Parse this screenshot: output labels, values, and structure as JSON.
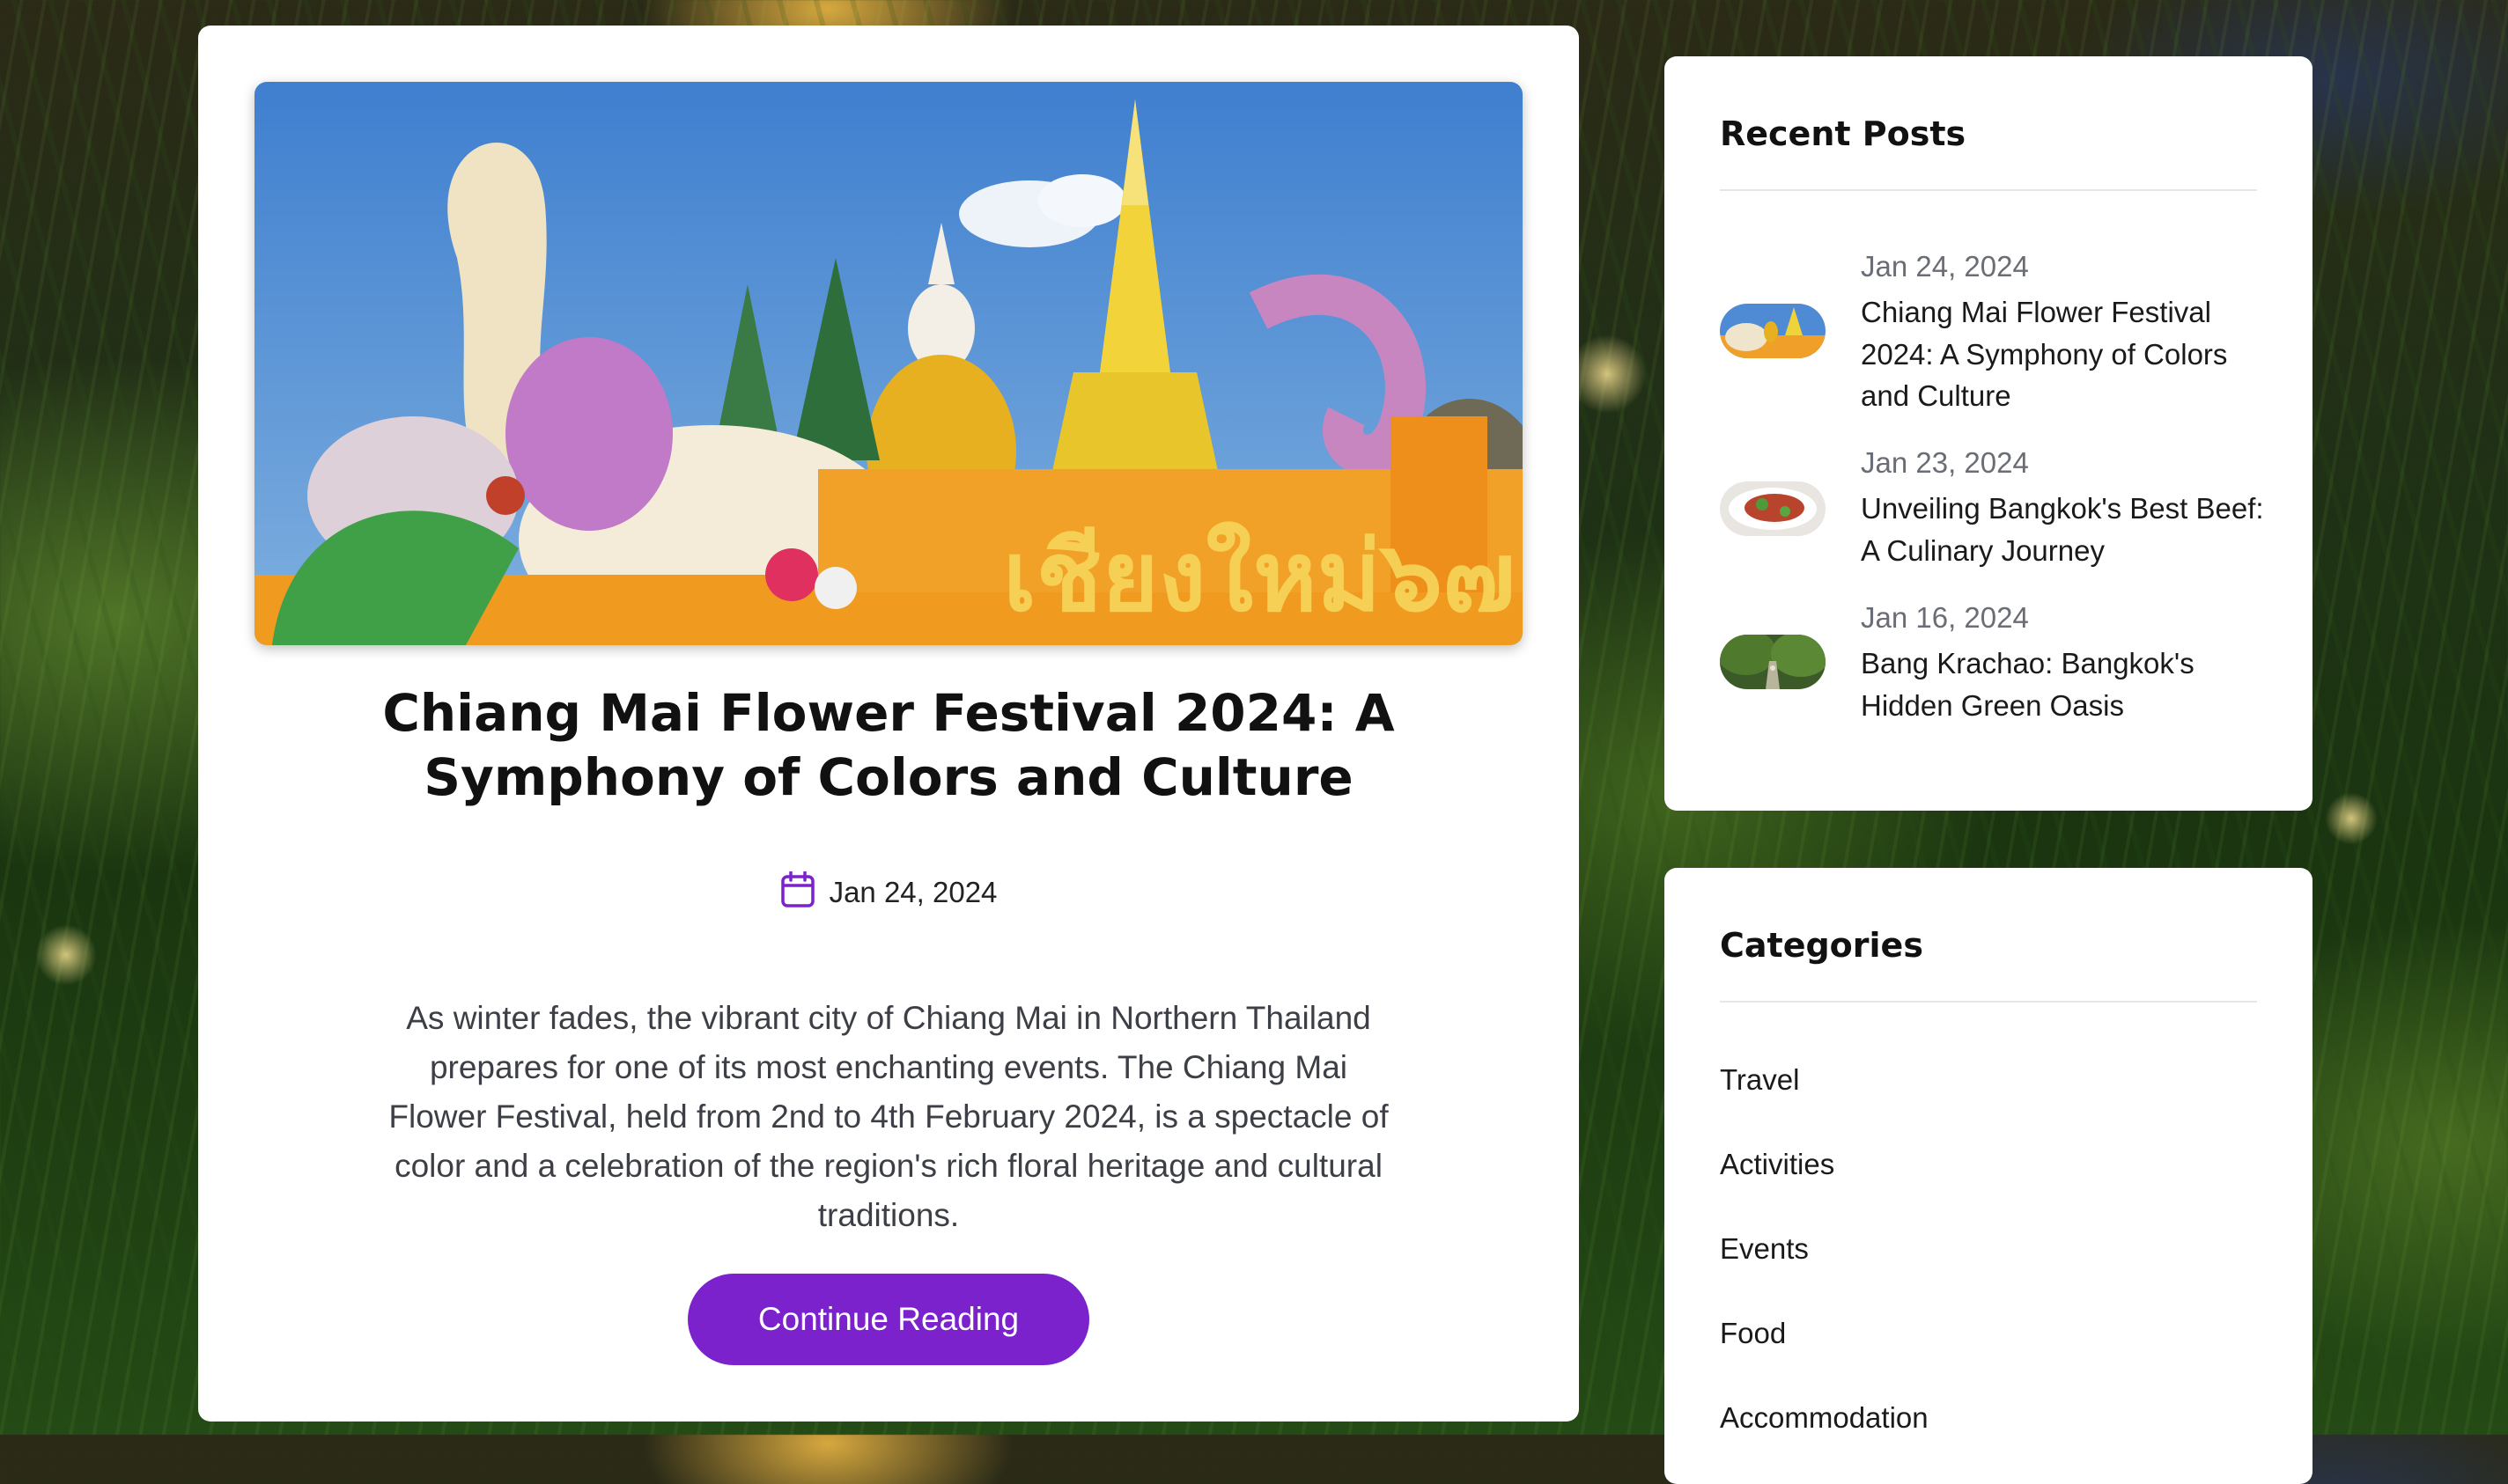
{
  "post": {
    "title": "Chiang Mai Flower Festival 2024: A Symphony of Colors and Culture",
    "date": "Jan 24, 2024",
    "excerpt": "As winter fades, the vibrant city of Chiang Mai in Northern Thailand prepares for one of its most enchanting events. The Chiang Mai Flower Festival, held from 2nd to 4th February 2024, is a spectacle of color and a celebration of the region's rich floral heritage and cultural traditions.",
    "cta_label": "Continue Reading",
    "date_icon": "calendar-icon"
  },
  "sidebar": {
    "recent": {
      "title": "Recent Posts",
      "items": [
        {
          "date": "Jan 24, 2024",
          "title": "Chiang Mai Flower Festival 2024: A Symphony of Colors and Culture"
        },
        {
          "date": "Jan 23, 2024",
          "title": "Unveiling Bangkok's Best Beef: A Culinary Journey"
        },
        {
          "date": "Jan 16, 2024",
          "title": "Bang Krachao: Bangkok's Hidden Green Oasis"
        }
      ]
    },
    "categories": {
      "title": "Categories",
      "items": [
        "Travel",
        "Activities",
        "Events",
        "Food",
        "Accommodation"
      ]
    }
  },
  "colors": {
    "accent": "#7b22cc",
    "card": "#ffffff",
    "text": "#111111"
  }
}
